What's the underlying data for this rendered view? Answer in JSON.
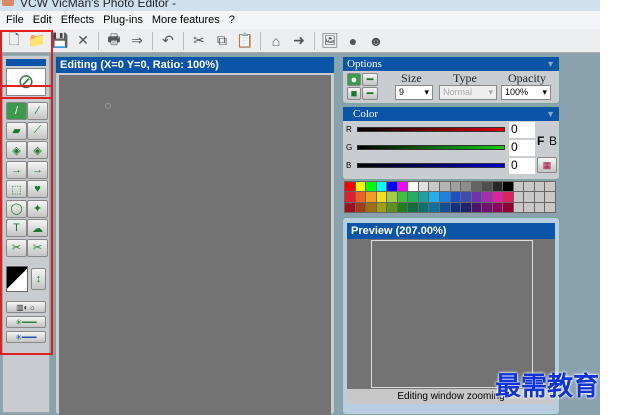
{
  "window": {
    "title": "VCW VicMan's Photo Editor -"
  },
  "menu": [
    "File",
    "Edit",
    "Effects",
    "Plug-ins",
    "More features",
    "?"
  ],
  "toolbar_icons": [
    "new-icon",
    "open-icon",
    "save-icon",
    "close-icon",
    "print-icon",
    "scan-icon",
    "undo-icon",
    "cut-icon",
    "copy-icon",
    "paste-icon",
    "home-icon",
    "export-icon",
    "image-icon",
    "mask-icon",
    "face-icon"
  ],
  "toolbar_glyphs": [
    "🗋",
    "📁",
    "💾",
    "✕",
    "🖶",
    "⇒",
    "↶",
    "✂",
    "⧉",
    "📋",
    "⌂",
    "➜",
    "🖼",
    "●",
    "☻"
  ],
  "tools": [
    "pencil",
    "brush",
    "eraser",
    "airbrush",
    "fill",
    "fill-gradient",
    "color-swap",
    "color-replace",
    "select-rect",
    "select-shape",
    "lasso",
    "magic-wand",
    "text",
    "stamp",
    "clone",
    "clone-plus"
  ],
  "tool_glyphs": [
    "/",
    "⁄",
    "▰",
    "⟋",
    "◈",
    "◈",
    "→",
    "→",
    "⬚",
    "♥",
    "◯",
    "✦",
    "T",
    "☁",
    "✂",
    "✂"
  ],
  "editing": {
    "title": "Editing (X=0 Y=0, Ratio: 100%)"
  },
  "options": {
    "title": "Options",
    "size_label": "Size",
    "size_value": "9",
    "type_label": "Type",
    "type_value": "Normal",
    "opacity_label": "Opacity",
    "opacity_value": "100%"
  },
  "color": {
    "title": "Color",
    "r_label": "R",
    "g_label": "G",
    "b_label": "B",
    "r": "0",
    "g": "0",
    "b": "0",
    "f_label": "F",
    "b_btn_label": "B"
  },
  "palette": [
    "#ff0000",
    "#ffff00",
    "#00ff00",
    "#00ffff",
    "#0000ff",
    "#ff00ff",
    "#ffffff",
    "#e0e0e0",
    "#c8c8c8",
    "#b4b4b4",
    "#a0a0a0",
    "#8c8c8c",
    "#646464",
    "#505050",
    "#282828",
    "#000000",
    "#c8c8c8",
    "#c8c8c8",
    "#c8c8c8",
    "#c8c8c8",
    "#e02030",
    "#f06020",
    "#f0a020",
    "#f0e020",
    "#a0d040",
    "#40c040",
    "#20b060",
    "#20a0a0",
    "#20b0f0",
    "#2080e0",
    "#2050c0",
    "#404cb0",
    "#7030b0",
    "#a030b0",
    "#e020a0",
    "#e02060",
    "#c8c8c8",
    "#c8c8c8",
    "#c8c8c8",
    "#c8c8c8",
    "#a01020",
    "#a04010",
    "#a07010",
    "#a0a010",
    "#609020",
    "#208020",
    "#107040",
    "#107070",
    "#1070a0",
    "#105090",
    "#103080",
    "#202070",
    "#501070",
    "#701070",
    "#900060",
    "#900030",
    "#c8c8c8",
    "#c8c8c8",
    "#c8c8c8",
    "#c8c8c8"
  ],
  "preview": {
    "title": "Preview (207.00%)",
    "status": "Editing window zooming"
  },
  "watermark": "最需教育"
}
